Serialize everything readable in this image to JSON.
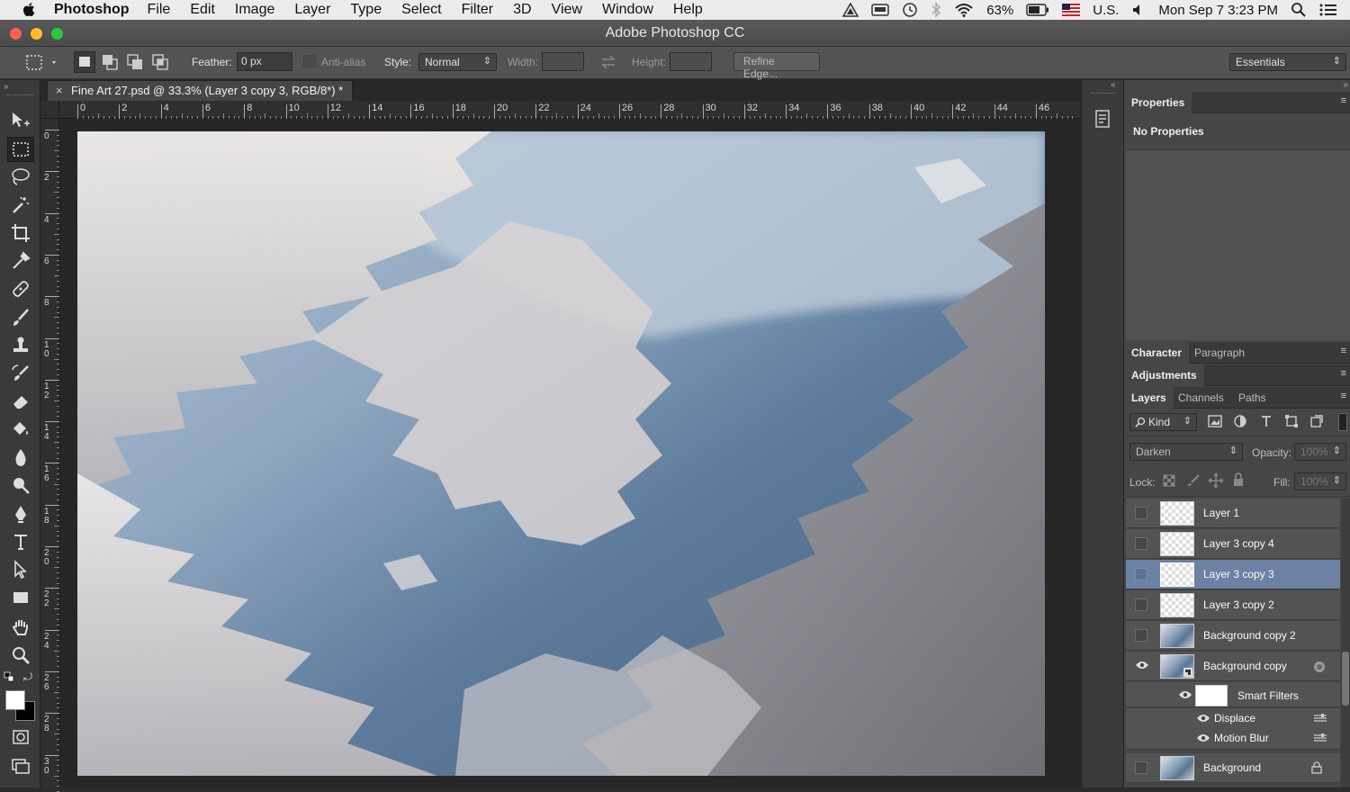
{
  "menubar": {
    "app": "Photoshop",
    "items": [
      "File",
      "Edit",
      "Image",
      "Layer",
      "Type",
      "Select",
      "Filter",
      "3D",
      "View",
      "Window",
      "Help"
    ],
    "battery": "63%",
    "input_source": "U.S.",
    "datetime": "Mon Sep 7  3:23 PM"
  },
  "window": {
    "title": "Adobe Photoshop CC"
  },
  "options": {
    "feather_label": "Feather:",
    "feather_value": "0 px",
    "antialias_label": "Anti-alias",
    "style_label": "Style:",
    "style_value": "Normal",
    "width_label": "Width:",
    "height_label": "Height:",
    "refine_edge": "Refine Edge...",
    "workspace": "Essentials"
  },
  "document": {
    "tab_title": "Fine Art 27.psd @ 33.3% (Layer 3 copy 3, RGB/8*) *",
    "ruler_h": [
      "0",
      "2",
      "4",
      "6",
      "8",
      "10",
      "12",
      "14",
      "16",
      "18",
      "20",
      "22",
      "24",
      "26",
      "28",
      "30",
      "32",
      "34",
      "36",
      "38",
      "40",
      "42",
      "44",
      "46"
    ],
    "ruler_v": [
      "0",
      "2",
      "4",
      "6",
      "8",
      "10",
      "12",
      "14",
      "16",
      "18",
      "20",
      "22",
      "24",
      "26",
      "28",
      "30"
    ]
  },
  "properties": {
    "tab": "Properties",
    "content": "No Properties"
  },
  "panels": {
    "character": "Character",
    "paragraph": "Paragraph",
    "adjustments": "Adjustments",
    "layers": "Layers",
    "channels": "Channels",
    "paths": "Paths"
  },
  "layers_panel": {
    "filter_kind": "Kind",
    "blend_mode": "Darken",
    "opacity_label": "Opacity:",
    "opacity_value": "100%",
    "lock_label": "Lock:",
    "fill_label": "Fill:",
    "fill_value": "100%",
    "layers": [
      {
        "name": "Layer 1"
      },
      {
        "name": "Layer 3 copy 4"
      },
      {
        "name": "Layer 3 copy 3"
      },
      {
        "name": "Layer 3 copy 2"
      },
      {
        "name": "Background copy 2"
      },
      {
        "name": "Background copy"
      },
      {
        "name": "Background"
      }
    ],
    "smart_filters_label": "Smart Filters",
    "filters": [
      "Displace",
      "Motion Blur"
    ]
  },
  "colors": {
    "selected_layer": "#6c82a5",
    "panel_bg": "#464646",
    "canvas_sky": "#7f95ae"
  }
}
